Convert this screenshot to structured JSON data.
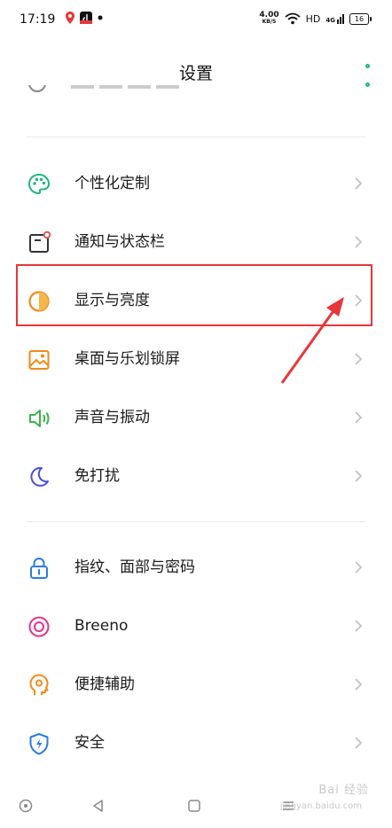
{
  "status_bar": {
    "time": "17:19",
    "net_speed_value": "4.00",
    "net_speed_unit": "KB/S",
    "hd_label": "HD",
    "signal_label": "4G",
    "battery_level": "16"
  },
  "header": {
    "title": "设置"
  },
  "sections": [
    {
      "items": [
        {
          "label": "个性化定制",
          "icon": "palette-icon",
          "color": "#1fb57c"
        },
        {
          "label": "通知与状态栏",
          "icon": "notification-icon",
          "color": "#e8494f"
        },
        {
          "label": "显示与亮度",
          "icon": "brightness-icon",
          "color": "#f08a1c"
        },
        {
          "label": "桌面与乐划锁屏",
          "icon": "wallpaper-icon",
          "color": "#f08a1c"
        },
        {
          "label": "声音与振动",
          "icon": "speaker-icon",
          "color": "#3cb34a"
        },
        {
          "label": "免打扰",
          "icon": "moon-icon",
          "color": "#4a4fd6"
        }
      ]
    },
    {
      "items": [
        {
          "label": "指纹、面部与密码",
          "icon": "lock-icon",
          "color": "#2a7de1"
        },
        {
          "label": "Breeno",
          "icon": "breeno-icon",
          "color": "#e0338f"
        },
        {
          "label": "便捷辅助",
          "icon": "assist-icon",
          "color": "#f08a1c"
        },
        {
          "label": "安全",
          "icon": "shield-icon",
          "color": "#2a7de1"
        }
      ]
    }
  ],
  "colors": {
    "accent": "#1fb57c",
    "highlight": "#e8363a",
    "chevron": "#c2c2c2"
  },
  "watermark": {
    "text": "Bai 经验",
    "sub": "jingyan.baidu.com"
  }
}
